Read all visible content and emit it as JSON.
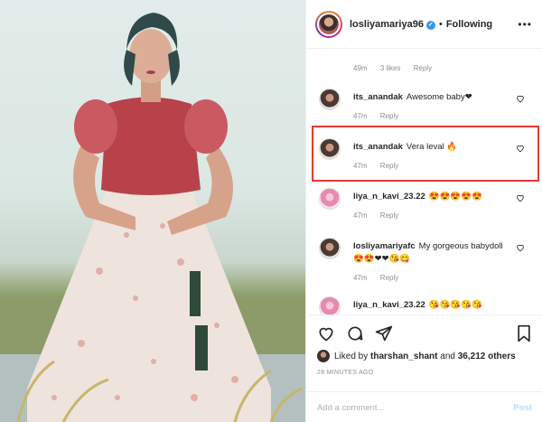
{
  "header": {
    "username": "losliyamariya96",
    "verified_mark": "✓",
    "separator": "•",
    "follow_status": "Following",
    "more": "•••"
  },
  "top_meta": {
    "time": "49m",
    "likes": "3 likes",
    "reply": "Reply"
  },
  "comments": [
    {
      "user": "its_anandak",
      "text": "Awesome baby❤",
      "time": "47m",
      "likes": "",
      "reply": "Reply"
    },
    {
      "user": "its_anandak",
      "text": "Vera leval 🔥",
      "time": "47m",
      "likes": "",
      "reply": "Reply"
    },
    {
      "user": "liya_n_kavi_23.22",
      "text": "😍😍😍😍😍",
      "time": "47m",
      "likes": "",
      "reply": "Reply"
    },
    {
      "user": "losliyamariyafc",
      "text": "My gorgeous babydoll😍😍❤❤😘😋",
      "time": "47m",
      "likes": "",
      "reply": "Reply"
    },
    {
      "user": "liya_n_kavi_23.22",
      "text": "😘😘😘😘😘",
      "time": "",
      "likes": "",
      "reply": ""
    }
  ],
  "likes_line": {
    "prefix": "Liked by",
    "user": "tharshan_shant",
    "and": "and",
    "count": "36,212 others"
  },
  "timestamp": "28 MINUTES AGO",
  "add_comment": {
    "placeholder": "Add a comment...",
    "post_label": "Post"
  },
  "icons": [
    "heart-icon",
    "comment-icon",
    "share-icon",
    "bookmark-icon",
    "more-icon"
  ],
  "colors": {
    "highlight": "#e53935",
    "verified": "#3897f0",
    "heart": "#ed4956"
  }
}
